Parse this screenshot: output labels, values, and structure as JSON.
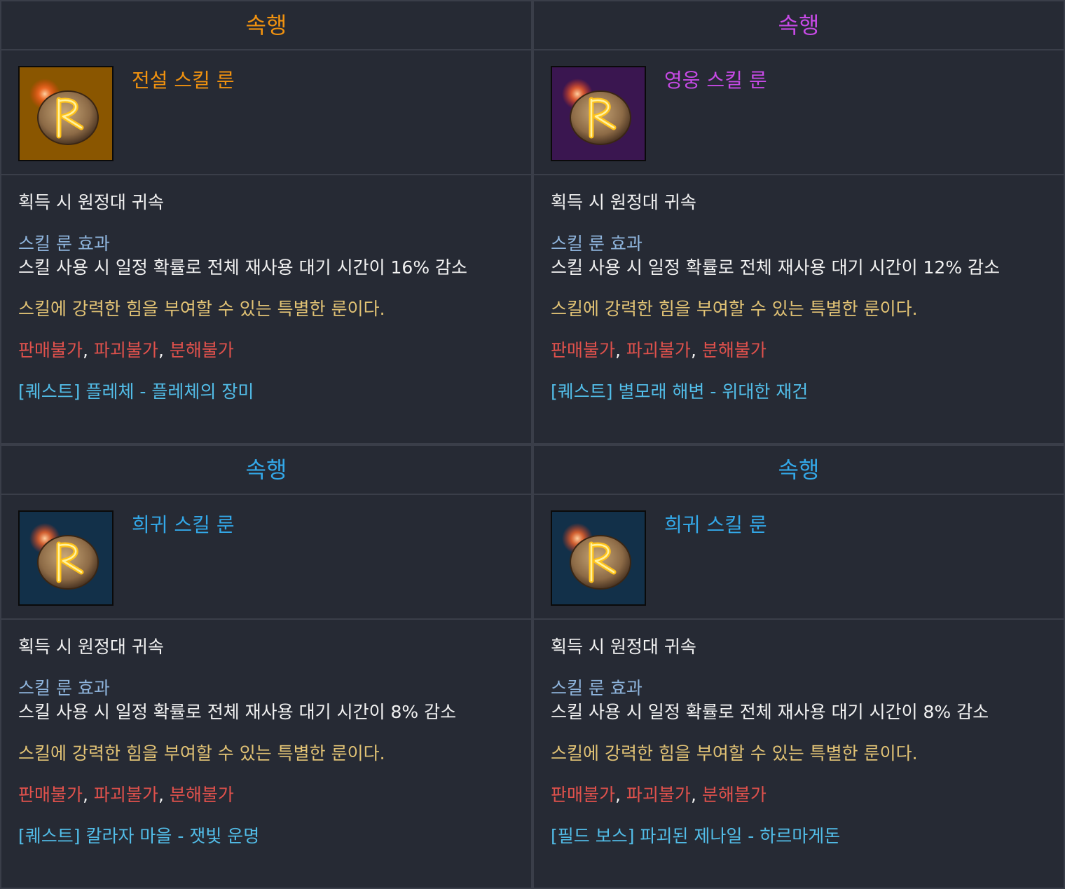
{
  "colors": {
    "legendary": "#f1920f",
    "heroic": "#c74ae6",
    "rare": "#33a8e8",
    "legendary_bg": "#8a5600",
    "heroic_bg": "#3a1650",
    "rare_bg": "#123049"
  },
  "cards": [
    {
      "rune_name": "속행",
      "item_name": "전설 스킬 룬",
      "grade": "legendary",
      "bind": "획득 시 원정대 귀속",
      "effect_title": "스킬 룬 효과",
      "effect_desc": "스킬 사용 시 일정 확률로 전체 재사용 대기 시간이 16% 감소",
      "flavor": "스킬에 강력한 힘을 부여할 수 있는 특별한 룬이다.",
      "restrictions": [
        "판매불가",
        "파괴불가",
        "분해불가"
      ],
      "separator": ", ",
      "source": "[퀘스트] 플레체 - 플레체의 장미"
    },
    {
      "rune_name": "속행",
      "item_name": "영웅 스킬 룬",
      "grade": "heroic",
      "bind": "획득 시 원정대 귀속",
      "effect_title": "스킬 룬 효과",
      "effect_desc": "스킬 사용 시 일정 확률로 전체 재사용 대기 시간이 12% 감소",
      "flavor": "스킬에 강력한 힘을 부여할 수 있는 특별한 룬이다.",
      "restrictions": [
        "판매불가",
        "파괴불가",
        "분해불가"
      ],
      "separator": ", ",
      "source": "[퀘스트] 별모래 해변 - 위대한 재건"
    },
    {
      "rune_name": "속행",
      "item_name": "희귀 스킬 룬",
      "grade": "rare",
      "bind": "획득 시 원정대 귀속",
      "effect_title": "스킬 룬 효과",
      "effect_desc": "스킬 사용 시 일정 확률로 전체 재사용 대기 시간이 8% 감소",
      "flavor": "스킬에 강력한 힘을 부여할 수 있는 특별한 룬이다.",
      "restrictions": [
        "판매불가",
        "파괴불가",
        "분해불가"
      ],
      "separator": ", ",
      "source": "[퀘스트] 칼라자 마을 - 잿빛 운명"
    },
    {
      "rune_name": "속행",
      "item_name": "희귀 스킬 룬",
      "grade": "rare",
      "bind": "획득 시 원정대 귀속",
      "effect_title": "스킬 룬 효과",
      "effect_desc": "스킬 사용 시 일정 확률로 전체 재사용 대기 시간이 8% 감소",
      "flavor": "스킬에 강력한 힘을 부여할 수 있는 특별한 룬이다.",
      "restrictions": [
        "판매불가",
        "파괴불가",
        "분해불가"
      ],
      "separator": ", ",
      "source": "[필드 보스] 파괴된 제나일 - 하르마게돈"
    }
  ]
}
